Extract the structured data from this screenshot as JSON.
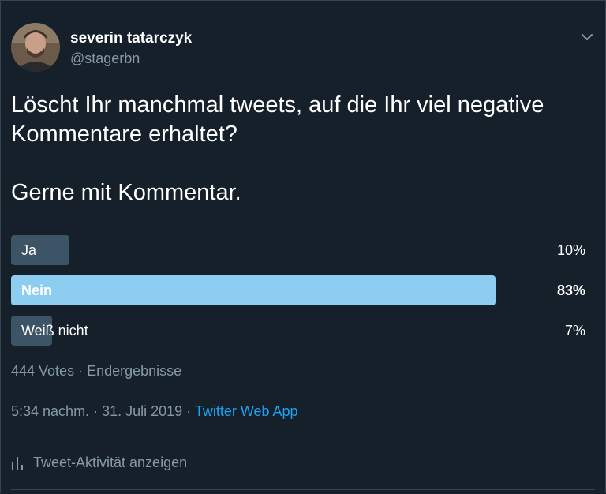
{
  "user": {
    "display_name": "severin tatarczyk",
    "handle": "@stagerbn"
  },
  "tweet": {
    "text_line1": "Löscht Ihr manchmal tweets, auf die Ihr viel negative",
    "text_line2": "Kommentare erhaltet?",
    "text_line3": "Gerne mit Kommentar."
  },
  "poll": {
    "options": [
      {
        "label": "Ja",
        "percent_text": "10%",
        "percent": 10,
        "winner": false
      },
      {
        "label": "Nein",
        "percent_text": "83%",
        "percent": 83,
        "winner": true
      },
      {
        "label": "Weiß nicht",
        "percent_text": "7%",
        "percent": 7,
        "winner": false
      }
    ],
    "meta": "444 Votes · Endergebnisse"
  },
  "footer": {
    "timestamp": "5:34 nachm. · 31. Juli 2019 · ",
    "source": "Twitter Web App",
    "activity_label": "Tweet-Aktivität anzeigen"
  },
  "colors": {
    "background": "#15202b",
    "bar": "#3d5466",
    "bar_winner": "#8ecdf2",
    "muted_text": "#8899a6",
    "link": "#1da1f2"
  },
  "icons": {
    "chevron": "chevron-down-icon",
    "activity": "bar-chart-icon"
  }
}
